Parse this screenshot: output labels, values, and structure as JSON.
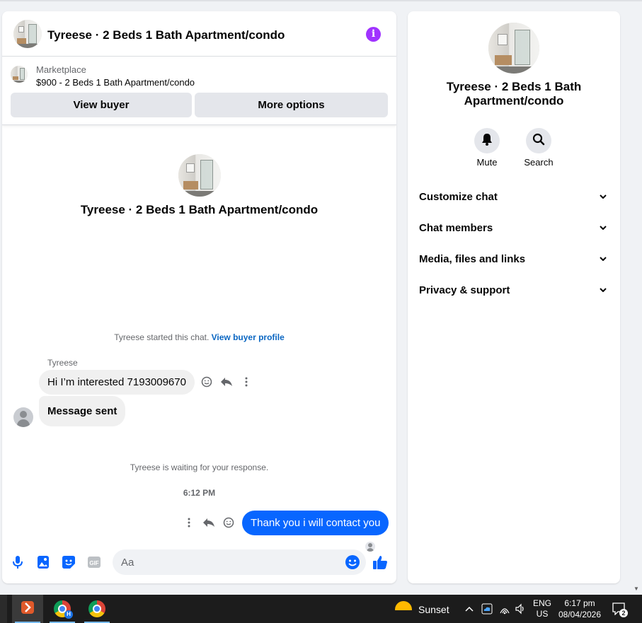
{
  "chat": {
    "header_title": "Tyreese · 2 Beds 1 Bath Apartment/condo",
    "info_icon": "info-icon",
    "listing": {
      "label": "Marketplace",
      "price_title": "$900 - 2 Beds 1 Bath Apartment/condo"
    },
    "buttons": {
      "view_buyer": "View buyer",
      "more_options": "More options"
    },
    "center_title": "Tyreese · 2 Beds 1 Bath Apartment/condo",
    "started_text": "Tyreese started this chat.",
    "view_buyer_profile": "View buyer profile",
    "sender_name": "Tyreese",
    "messages_in": [
      {
        "text": "Hi I’m interested 7193009670"
      },
      {
        "text": "Message sent"
      }
    ],
    "waiting_text": "Tyreese is waiting for your response.",
    "timestamp": "6:12 PM",
    "message_out": "Thank you i will contact you",
    "composer_placeholder": "Aa",
    "accent_color": "#0866ff"
  },
  "info_panel": {
    "title_line1": "Tyreese · 2 Beds 1 Bath",
    "title_line2": "Apartment/condo",
    "actions": [
      {
        "label": "Mute",
        "icon": "bell-icon"
      },
      {
        "label": "Search",
        "icon": "search-icon"
      }
    ],
    "sections": [
      {
        "label": "Customize chat"
      },
      {
        "label": "Chat members"
      },
      {
        "label": "Media, files and links"
      },
      {
        "label": "Privacy & support"
      }
    ]
  },
  "taskbar": {
    "weather_label": "Sunset",
    "lang_top": "ENG",
    "lang_bottom": "US",
    "time": "6:17 pm",
    "date": "08/04/2026",
    "notification_count": "2",
    "chrome_badge": "H"
  }
}
